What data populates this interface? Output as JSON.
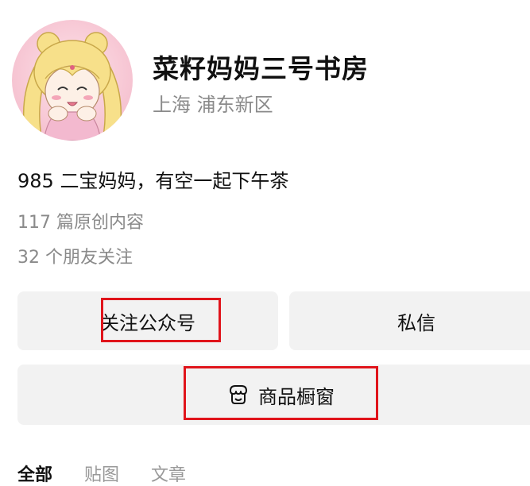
{
  "profile": {
    "name": "菜籽妈妈三号书房",
    "location": "上海 浦东新区",
    "bio": "985 二宝妈妈，有空一起下午茶",
    "articles": "117 篇原创内容",
    "friends": "32 个朋友关注"
  },
  "buttons": {
    "follow": "关注公众号",
    "message": "私信",
    "shop": "商品橱窗",
    "shop_icon": "storefront-icon"
  },
  "tabs": [
    "全部",
    "贴图",
    "文章"
  ],
  "colors": {
    "highlight": "#e0141b",
    "button_bg": "#f2f2f2",
    "secondary_text": "#8a8a8a"
  }
}
